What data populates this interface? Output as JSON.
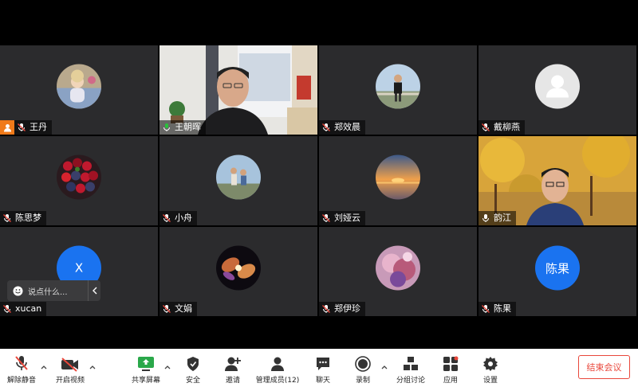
{
  "participants": [
    {
      "name": "王丹",
      "avatar": "photo-portrait",
      "host": true
    },
    {
      "name": "王朝晖",
      "avatar": "video",
      "speaking": true
    },
    {
      "name": "郑效晨",
      "avatar": "photo-portrait"
    },
    {
      "name": "戴柳燕",
      "avatar": "default-user-icon"
    },
    {
      "name": "陈思梦",
      "avatar": "photo-berries"
    },
    {
      "name": "小舟",
      "avatar": "photo-people"
    },
    {
      "name": "刘娅云",
      "avatar": "photo-sunset"
    },
    {
      "name": "韵江",
      "avatar": "video"
    },
    {
      "name": "xucan",
      "avatar_letter": "X"
    },
    {
      "name": "文娟",
      "avatar": "photo-nebula"
    },
    {
      "name": "郑伊珍",
      "avatar": "photo-art"
    },
    {
      "name": "陈果",
      "avatar_letter": "陈果"
    }
  ],
  "chat_popup": {
    "placeholder": "说点什么..."
  },
  "toolbar": {
    "unmute": "解除静音",
    "start_video": "开启视频",
    "share_screen": "共享屏幕",
    "security": "安全",
    "invite": "邀请",
    "manage_members": "管理成员(12)",
    "chat": "聊天",
    "record": "录制",
    "breakout": "分组讨论",
    "apps": "应用",
    "settings": "设置",
    "end_meeting": "结束会议"
  },
  "colors": {
    "accent_blue": "#1a73f0",
    "end_red": "#e9473b",
    "speaking_green": "#28c23b",
    "host_orange": "#f07a1a",
    "tile_bg": "#2b2b2d"
  }
}
